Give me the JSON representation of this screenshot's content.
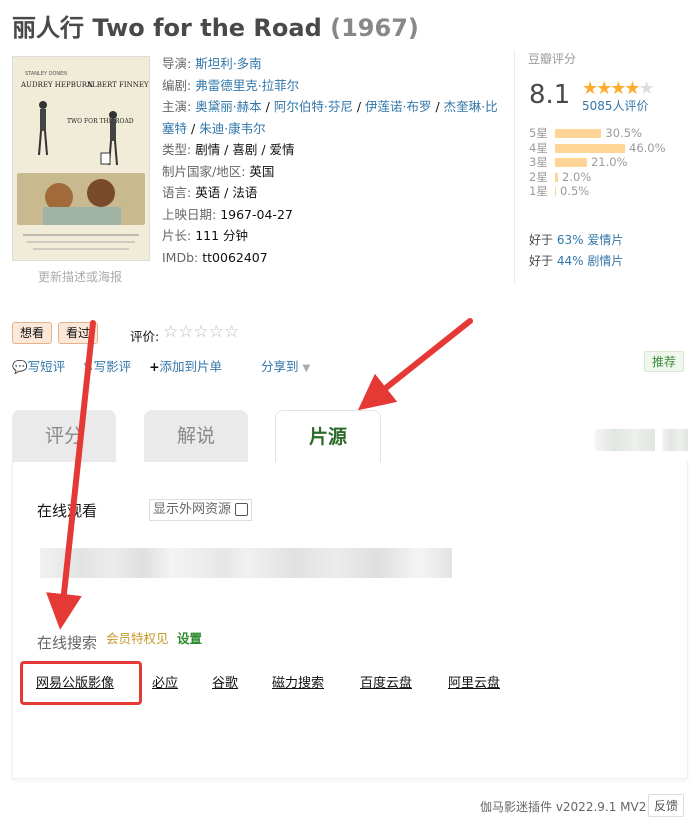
{
  "title": {
    "name": "丽人行 Two for the Road",
    "year": "(1967)"
  },
  "poster": {
    "caption": "更新描述或海报",
    "texts": [
      "AUDREY HEPBURN",
      "ALBERT FINNEY",
      "TWO FOR THE ROAD"
    ]
  },
  "info": {
    "director_label": "导演:",
    "director": "斯坦利·多南",
    "writer_label": "编剧:",
    "writer": "弗雷德里克·拉菲尔",
    "cast_label": "主演:",
    "cast": [
      "奥黛丽·赫本",
      "阿尔伯特·芬尼",
      "伊莲诺·布罗",
      "杰奎琳·比塞特",
      "朱迪·康韦尔"
    ],
    "genre_label": "类型:",
    "genre": "剧情 / 喜剧 / 爱情",
    "country_label": "制片国家/地区:",
    "country": "英国",
    "language_label": "语言:",
    "language": "英语 / 法语",
    "release_label": "上映日期:",
    "release": "1967-04-27",
    "runtime_label": "片长:",
    "runtime": "111 分钟",
    "imdb_label": "IMDb:",
    "imdb": "tt0062407"
  },
  "rating": {
    "label": "豆瓣评分",
    "score": "8.1",
    "star_count": 4,
    "votes": "5085人评价",
    "breakdown": [
      {
        "star": "5星",
        "pct": "30.5%",
        "value": 30.5
      },
      {
        "star": "4星",
        "pct": "46.0%",
        "value": 46.0
      },
      {
        "star": "3星",
        "pct": "21.0%",
        "value": 21.0
      },
      {
        "star": "2星",
        "pct": "2.0%",
        "value": 2.0
      },
      {
        "star": "1星",
        "pct": "0.5%",
        "value": 0.5
      }
    ],
    "better": [
      {
        "prefix": "好于 ",
        "pct": "63%",
        "genre": " 爱情片"
      },
      {
        "prefix": "好于 ",
        "pct": "44%",
        "genre": " 剧情片"
      }
    ]
  },
  "actions": {
    "want": "想看",
    "seen": "看过",
    "rate_label": "评价:"
  },
  "links": {
    "short_review": "写短评",
    "review": "写影评",
    "add_list": "添加到片单",
    "share": "分享到",
    "recommend": "推荐"
  },
  "tabs": [
    {
      "label": "评分"
    },
    {
      "label": "解说"
    },
    {
      "label": "片源"
    }
  ],
  "panel": {
    "online_watch": "在线观看",
    "ext_res": "显示外网资源",
    "online_search": "在线搜索",
    "vip": "会员特权见",
    "settings": "设置",
    "search_links": [
      "网易公版影像",
      "必应",
      "谷歌",
      "磁力搜索",
      "百度云盘",
      "阿里云盘"
    ]
  },
  "footer": {
    "plugin": "伽马影迷插件 v2022.9.1 MV2",
    "feedback": "反馈"
  },
  "colors": {
    "link": "#3377aa",
    "star": "#ffac2d",
    "bar": "#ffd596",
    "active_tab": "#2d6a2d",
    "annotation": "#e53935"
  }
}
